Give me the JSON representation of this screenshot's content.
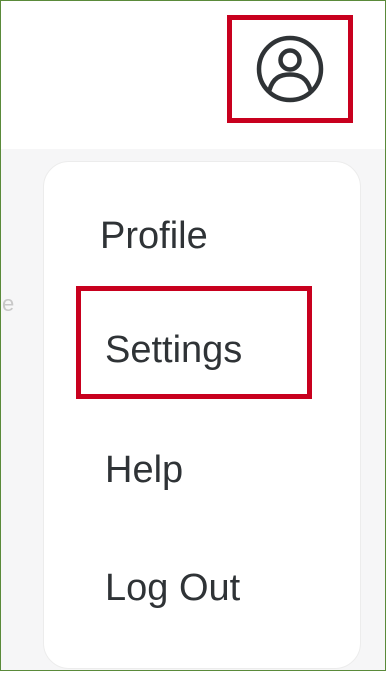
{
  "header": {
    "account_icon": "user-circle-icon",
    "highlight_color": "#c8001e"
  },
  "menu": {
    "items": [
      {
        "label": "Profile"
      },
      {
        "label": "Settings",
        "highlighted": true
      },
      {
        "label": "Help"
      },
      {
        "label": "Log Out"
      }
    ]
  },
  "colors": {
    "text": "#2f3336",
    "page_background": "#f6f6f7",
    "menu_background": "#ffffff",
    "highlight": "#c8001e"
  }
}
